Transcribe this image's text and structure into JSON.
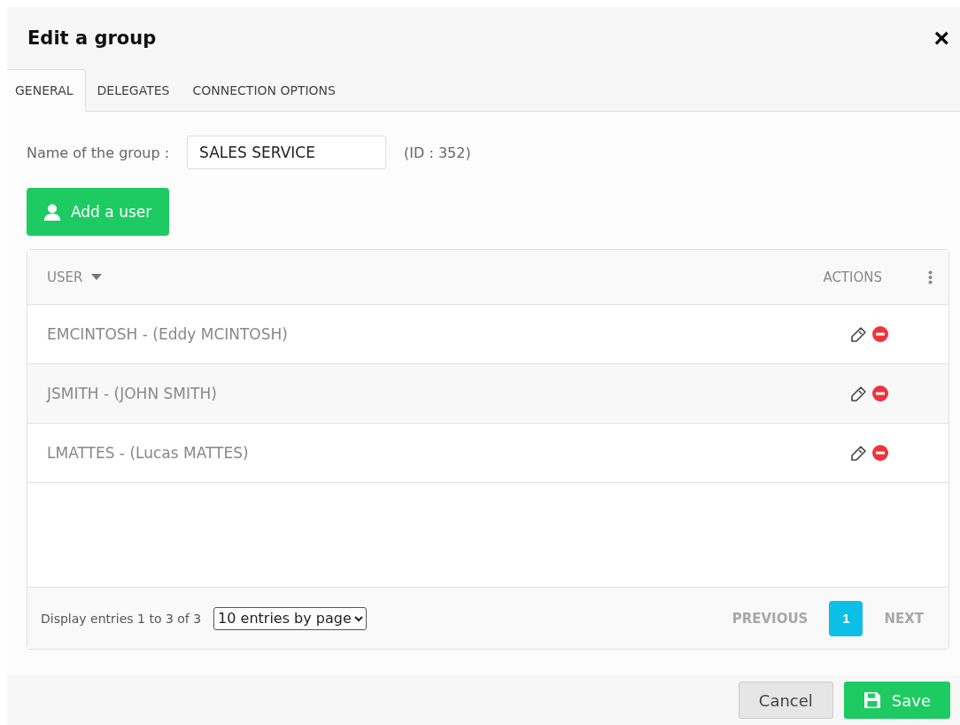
{
  "dialog": {
    "title": "Edit a group",
    "close": "×"
  },
  "tabs": [
    {
      "label": "GENERAL",
      "selected": true
    },
    {
      "label": "DELEGATES",
      "selected": false
    },
    {
      "label": "CONNECTION OPTIONS",
      "selected": false
    }
  ],
  "group_name": {
    "label": "Name of the group :",
    "value": "SALES SERVICE",
    "id_text": "(ID : 352)"
  },
  "add_button": "Add a user",
  "table": {
    "columns": [
      "USER",
      "ACTIONS"
    ],
    "rows": [
      {
        "user": "EMCINTOSH - (Eddy MCINTOSH)"
      },
      {
        "user": "JSMITH - (JOHN SMITH)"
      },
      {
        "user": "LMATTES - (Lucas MATTES)"
      }
    ]
  },
  "pagination": {
    "info": "Display entries 1 to 3 of 3",
    "page_size": "10 entries by page",
    "previous": "PREVIOUS",
    "pages": [
      {
        "label": "1",
        "selected": true
      }
    ],
    "next": "NEXT"
  },
  "buttons": {
    "cancel": "Cancel",
    "save": "Save"
  }
}
